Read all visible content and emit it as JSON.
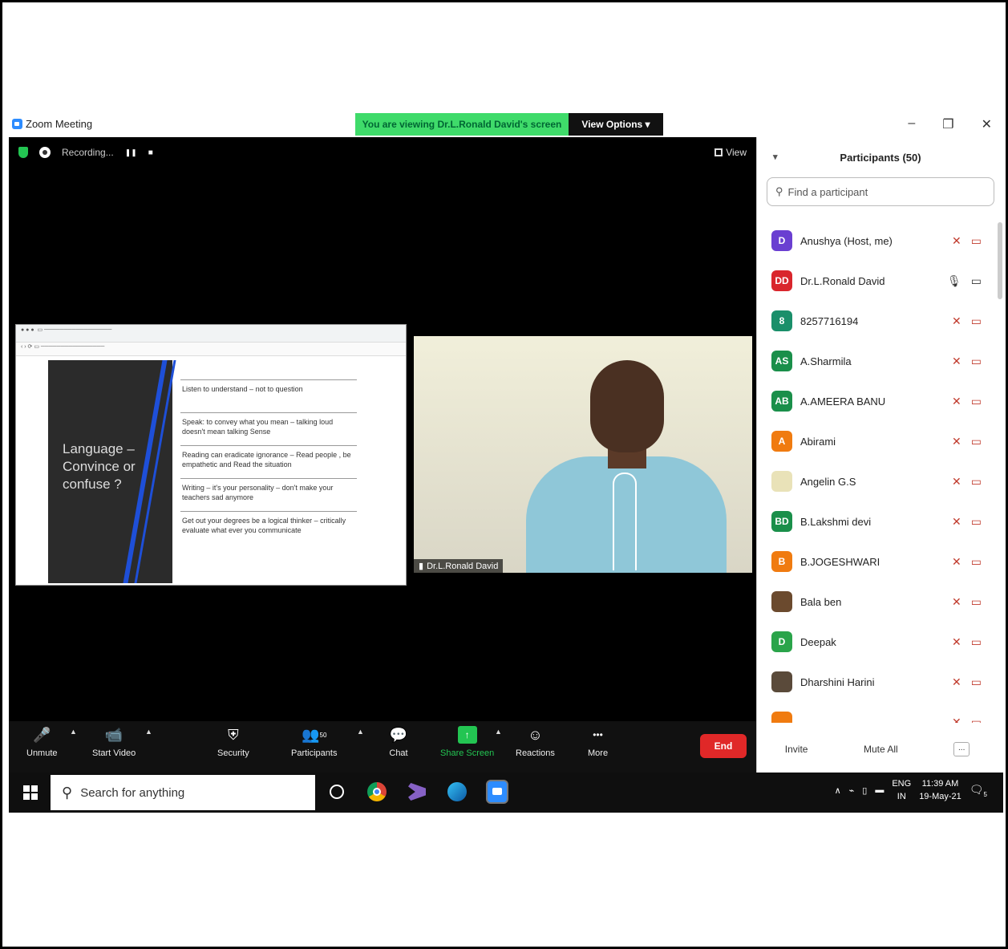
{
  "window": {
    "app_title": "Zoom Meeting",
    "share_banner": "You are viewing Dr.L.Ronald David's screen",
    "view_options": "View Options",
    "minimize": "–",
    "restore": "❐",
    "close": "✕"
  },
  "meeting": {
    "recording_label": "Recording...",
    "pause": "❚❚",
    "stop": "■",
    "view_label": "View",
    "slide": {
      "title": "Language – Convince or confuse ?",
      "points": [
        "Listen to understand – not to question",
        "Speak: to convey what you mean – talking loud doesn't mean talking Sense",
        "Reading can eradicate ignorance – Read people , be empathetic and Read the situation",
        "Writing – it's your personality – don't make your teachers sad anymore",
        "Get out your degrees be a logical thinker – critically evaluate what ever you communicate"
      ]
    },
    "speaker_name": "Dr.L.Ronald David"
  },
  "toolbar": {
    "items": [
      {
        "icon": "🎤",
        "label": "Unmute"
      },
      {
        "icon": "📹",
        "label": "Start Video"
      },
      {
        "icon": "⛨",
        "label": "Security"
      },
      {
        "icon": "👥",
        "label": "Participants",
        "count": "50"
      },
      {
        "icon": "💬",
        "label": "Chat"
      },
      {
        "icon": "↑",
        "label": "Share Screen"
      },
      {
        "icon": "☺",
        "label": "Reactions"
      },
      {
        "icon": "•••",
        "label": "More"
      }
    ],
    "end_label": "End"
  },
  "participants": {
    "title": "Participants (50)",
    "search_placeholder": "Find a participant",
    "list": [
      {
        "initials": "D",
        "color": "#6a3fd1",
        "name": "Anushya (Host, me)"
      },
      {
        "initials": "DD",
        "color": "#d9262c",
        "name": "Dr.L.Ronald David"
      },
      {
        "initials": "8",
        "color": "#1a8f6a",
        "name": "8257716194"
      },
      {
        "initials": "AS",
        "color": "#1a8f4a",
        "name": "A.Sharmila"
      },
      {
        "initials": "AB",
        "color": "#1a8f4a",
        "name": "A.AMEERA BANU"
      },
      {
        "initials": "A",
        "color": "#f07b10",
        "name": "Abirami"
      },
      {
        "initials": "",
        "color": "#e9e2b8",
        "name": "Angelin G.S"
      },
      {
        "initials": "BD",
        "color": "#1a8f4a",
        "name": "B.Lakshmi devi"
      },
      {
        "initials": "B",
        "color": "#f07b10",
        "name": "B.JOGESHWARI"
      },
      {
        "initials": "",
        "color": "#6b4a2e",
        "name": "Bala ben"
      },
      {
        "initials": "D",
        "color": "#2aa44a",
        "name": "Deepak"
      },
      {
        "initials": "",
        "color": "#5a4a3a",
        "name": "Dharshini Harini"
      },
      {
        "initials": "",
        "color": "#f07b10",
        "name": "..."
      }
    ],
    "invite": "Invite",
    "mute_all": "Mute All",
    "more": "..."
  },
  "taskbar": {
    "search_placeholder": "Search for anything",
    "lang_top": "ENG",
    "lang_bottom": "IN",
    "time": "11:39 AM",
    "date": "19-May-21",
    "notif_count": "5"
  }
}
